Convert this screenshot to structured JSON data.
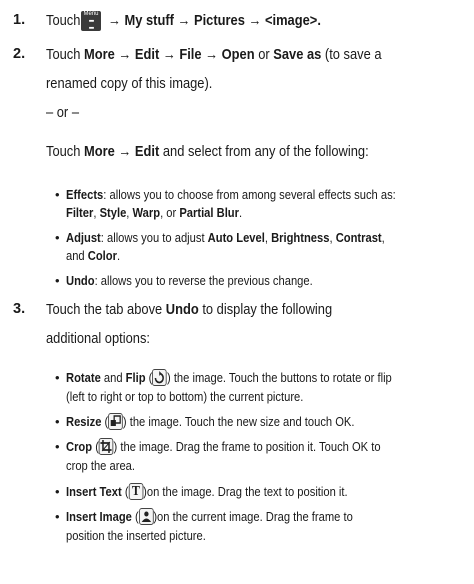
{
  "steps": [
    {
      "num": "1.",
      "t1": "Touch",
      "t2": "→ My stuff → Pictures → <image>."
    },
    {
      "num": "2.",
      "line1_pre": "Touch ",
      "line1_b": "More → Edit → File → Open",
      "line1_mid": " or ",
      "line1_b2": "Save as",
      "line1_post": " (to save a",
      "line2": "renamed copy of this image).",
      "or": "– or –",
      "line3_pre": "Touch ",
      "line3_b": "More → Edit",
      "line3_post": " and select from any of the following:"
    },
    {
      "num": "3.",
      "line1": "Touch the tab above ",
      "line1_b": "Undo",
      "line1_post": " to display the following",
      "line2": "additional options:"
    }
  ],
  "menu_icon_label": "Menu",
  "bullets2": [
    {
      "b": "Effects",
      "t": ": allows you to choose from among several effects such as:",
      "b2": "Filter",
      "c1": ", ",
      "b3": "Style",
      "c2": ", ",
      "b4": "Warp",
      "c3": ", or ",
      "b5": "Partial Blur",
      "end": "."
    },
    {
      "b": "Adjust",
      "t": ": allows you to adjust ",
      "b2": "Auto Level",
      "c1": ", ",
      "b3": "Brightness",
      "c2": ", ",
      "b4": "Contrast",
      "c3": ",",
      "l2pre": "and ",
      "b5": "Color",
      "end": "."
    },
    {
      "b": "Undo",
      "t": ": allows you to reverse the previous change."
    }
  ],
  "bullets3": [
    {
      "b": "Rotate",
      "t1": " and ",
      "b2": "Flip",
      "t2": " (",
      "t3": ") the image. Touch the buttons to rotate or flip",
      "l2": "(left to right or top to bottom) the current picture."
    },
    {
      "b": "Resize",
      "t2": " (",
      "t3": ") the image. Touch the new size and touch OK."
    },
    {
      "b": "Crop",
      "t2": " (",
      "t3": ") the image. Drag the frame to position it. Touch OK to",
      "l2": "crop the area."
    },
    {
      "b": "Insert Text",
      "t2": " (",
      "t3": ")on the image. Drag the text to position it."
    },
    {
      "b": "Insert Image",
      "t2": " (",
      "t3": ")on the current image. Drag the frame to",
      "l2": "position the inserted picture."
    }
  ]
}
